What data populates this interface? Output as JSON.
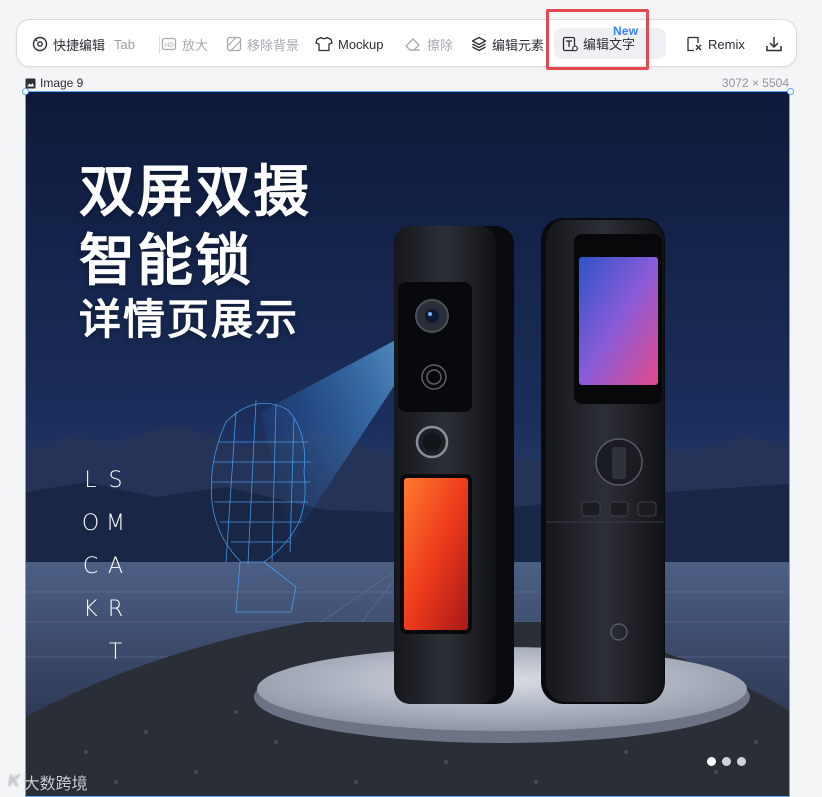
{
  "toolbar": {
    "quick_edit": "快捷编辑",
    "quick_edit_shortcut": "Tab",
    "upscale": "放大",
    "remove_bg": "移除背景",
    "mockup": "Mockup",
    "erase": "擦除",
    "edit_elements": "编辑元素",
    "edit_text": "编辑文字",
    "edit_text_badge": "New",
    "more": "···",
    "remix": "Remix"
  },
  "image": {
    "name": "Image 9",
    "dimensions": "3072 × 5504",
    "headline_1": "双屏双摄",
    "headline_2": "智能锁",
    "headline_3": "详情页展示",
    "vertical_text": "SMART LOCK"
  },
  "watermark": {
    "logo": "K",
    "text": "大数跨境"
  },
  "colors": {
    "highlight": "#e5484d",
    "selection": "#5aa9ff",
    "badge": "#3b82f6"
  }
}
